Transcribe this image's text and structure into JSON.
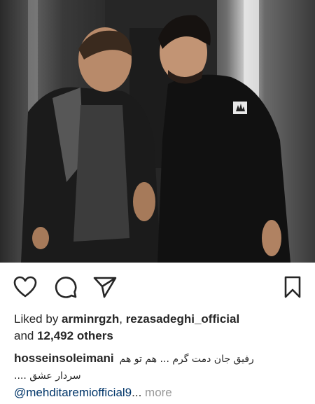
{
  "post": {
    "photo_alt": "",
    "brand_patch": "adidas"
  },
  "actions": {
    "like_icon": "heart-icon",
    "comment_icon": "comment-icon",
    "share_icon": "paper-plane-icon",
    "save_icon": "bookmark-icon"
  },
  "likes": {
    "prefix": "Liked by ",
    "user1": "arminrgzh",
    "separator": ", ",
    "user2": "rezasadeghi_official",
    "and": "and ",
    "others": "12,492 others"
  },
  "caption": {
    "username": "hosseinsoleimani",
    "text_line1": "رفیق جان دمت گرم ... هم تو هم",
    "text_line2": "سردار عشق ....",
    "mention": "@mehditaremiofficial9",
    "ellipsis": "...",
    "more": "more"
  },
  "colors": {
    "text": "#262626",
    "mention": "#003569",
    "more": "#999999"
  }
}
